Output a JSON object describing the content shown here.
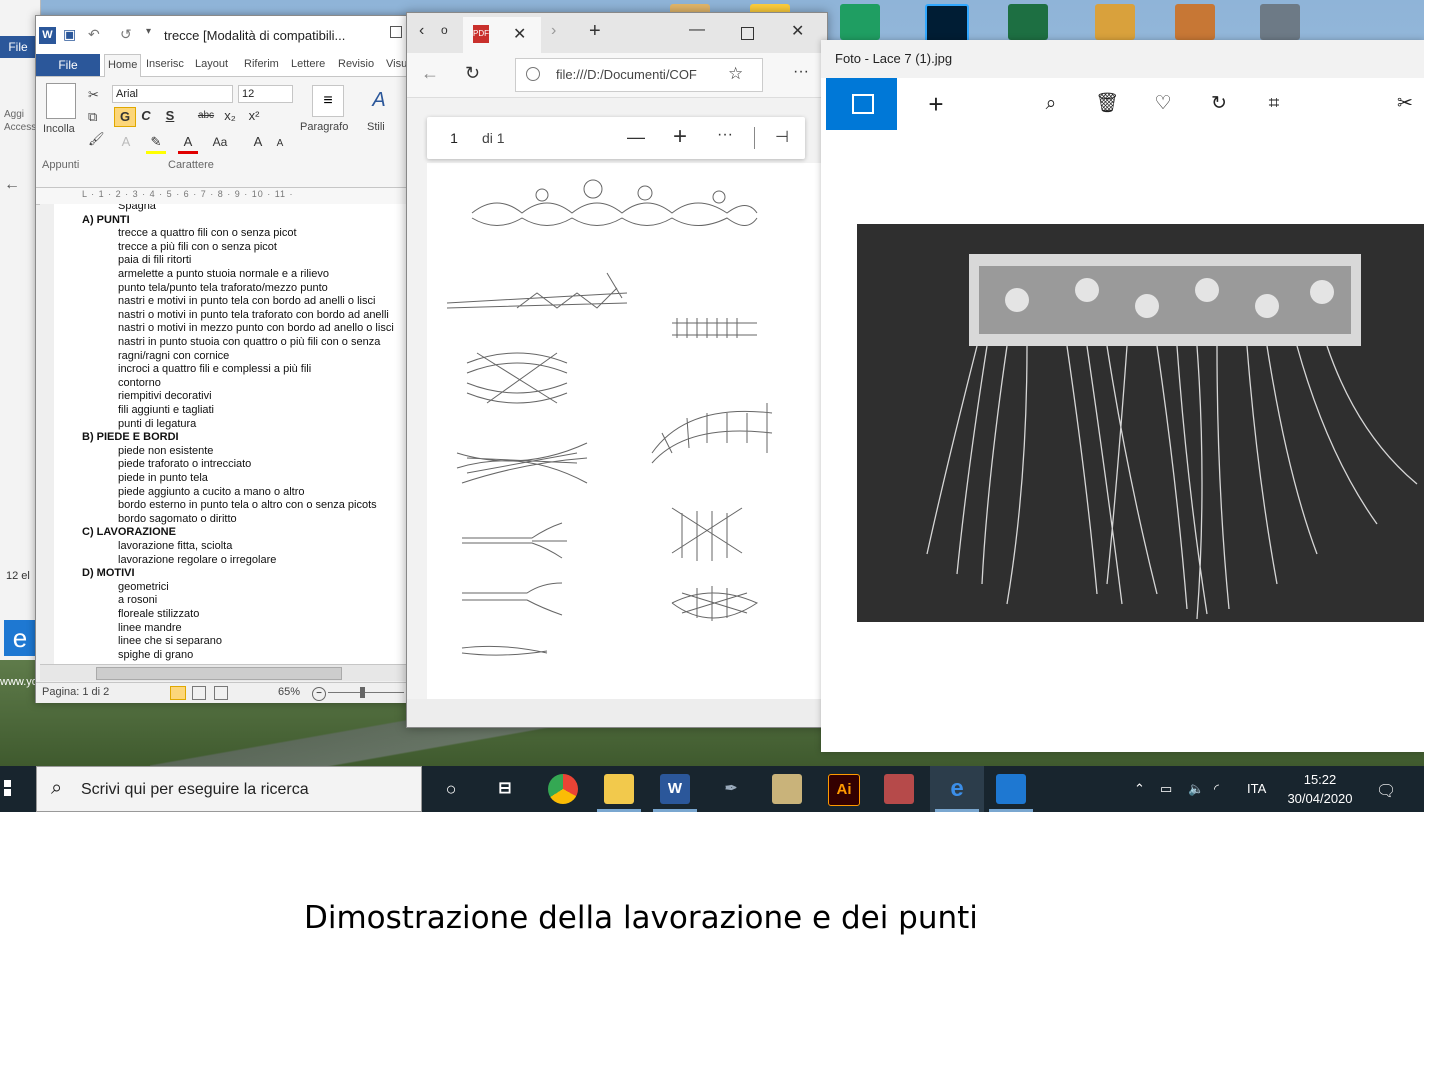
{
  "desktop": {
    "left_window": {
      "file_label": "File",
      "add_label": "Aggi",
      "access_label": "Access",
      "zoom_fragment": "12 el",
      "site_fragment": "www.yo"
    }
  },
  "word": {
    "title": "trecce [Modalità di compatibili...",
    "tabs": [
      "File",
      "Home",
      "Inserisc",
      "Layout",
      "Riferim",
      "Lettere",
      "Revisio",
      "Visu"
    ],
    "ribbon": {
      "paste_label": "Incolla",
      "font_name": "Arial",
      "font_size": "12",
      "bold": "G",
      "italic": "C",
      "underline": "S",
      "strike": "abc",
      "paragraph_label": "Paragrafo",
      "styles_label": "Stili",
      "clipboard_group": "Appunti",
      "font_group": "Carattere"
    },
    "ruler_text": "L · 1 · 2 · 3 · 4 · 5 · 6 · 7 · 8 · 9 · 10 · 11 ·",
    "document_lines": [
      {
        "text": "Spagna",
        "heading": false
      },
      {
        "text": "A) PUNTI",
        "heading": true
      },
      {
        "text": "trecce a quattro fili con o senza picot",
        "heading": false
      },
      {
        "text": "trecce a più fili con o senza picot",
        "heading": false
      },
      {
        "text": "paia di fili ritorti",
        "heading": false
      },
      {
        "text": "armelette a punto stuoia normale e a rilievo",
        "heading": false
      },
      {
        "text": "punto tela/punto tela traforato/mezzo punto",
        "heading": false
      },
      {
        "text": "nastri e motivi in punto tela con bordo ad anelli o lisci",
        "heading": false
      },
      {
        "text": "nastri o motivi in punto tela traforato con bordo ad anelli",
        "heading": false
      },
      {
        "text": "nastri o motivi in mezzo punto con bordo ad anello o lisci",
        "heading": false
      },
      {
        "text": "nastri in punto stuoia con quattro o più fili con o senza",
        "heading": false
      },
      {
        "text": "ragni/ragni con cornice",
        "heading": false
      },
      {
        "text": "incroci a quattro fili e complessi a più fili",
        "heading": false
      },
      {
        "text": "contorno",
        "heading": false
      },
      {
        "text": "riempitivi decorativi",
        "heading": false
      },
      {
        "text": "fili aggiunti e tagliati",
        "heading": false
      },
      {
        "text": "punti di legatura",
        "heading": false
      },
      {
        "text": "B) PIEDE E BORDI",
        "heading": true
      },
      {
        "text": "piede non esistente",
        "heading": false
      },
      {
        "text": "piede traforato o intrecciato",
        "heading": false
      },
      {
        "text": "piede in punto tela",
        "heading": false
      },
      {
        "text": "piede aggiunto a cucito a mano o altro",
        "heading": false
      },
      {
        "text": "bordo esterno in punto tela o altro con o senza picots",
        "heading": false
      },
      {
        "text": "bordo sagomato o diritto",
        "heading": false
      },
      {
        "text": "C) LAVORAZIONE",
        "heading": true
      },
      {
        "text": "lavorazione fitta, sciolta",
        "heading": false
      },
      {
        "text": "lavorazione regolare o irregolare",
        "heading": false
      },
      {
        "text": "D) MOTIVI",
        "heading": true
      },
      {
        "text": "geometrici",
        "heading": false
      },
      {
        "text": "a rosoni",
        "heading": false
      },
      {
        "text": "floreale stilizzato",
        "heading": false
      },
      {
        "text": "linee mandre",
        "heading": false
      },
      {
        "text": "linee che si separano",
        "heading": false
      },
      {
        "text": "spighe di grano",
        "heading": false
      }
    ],
    "status": {
      "page": "Pagina: 1 di 2",
      "zoom": "65%"
    }
  },
  "edge": {
    "url": "file:///D:/Documenti/COF",
    "pdf": {
      "page_number": "1",
      "page_total": "di 1"
    }
  },
  "photos": {
    "title": "Foto - Lace 7 (1).jpg"
  },
  "taskbar": {
    "search_placeholder": "Scrivi qui per eseguire la ricerca",
    "language": "ITA",
    "time": "15:22",
    "date": "30/04/2020"
  },
  "caption": "Dimostrazione della lavorazione e dei punti"
}
